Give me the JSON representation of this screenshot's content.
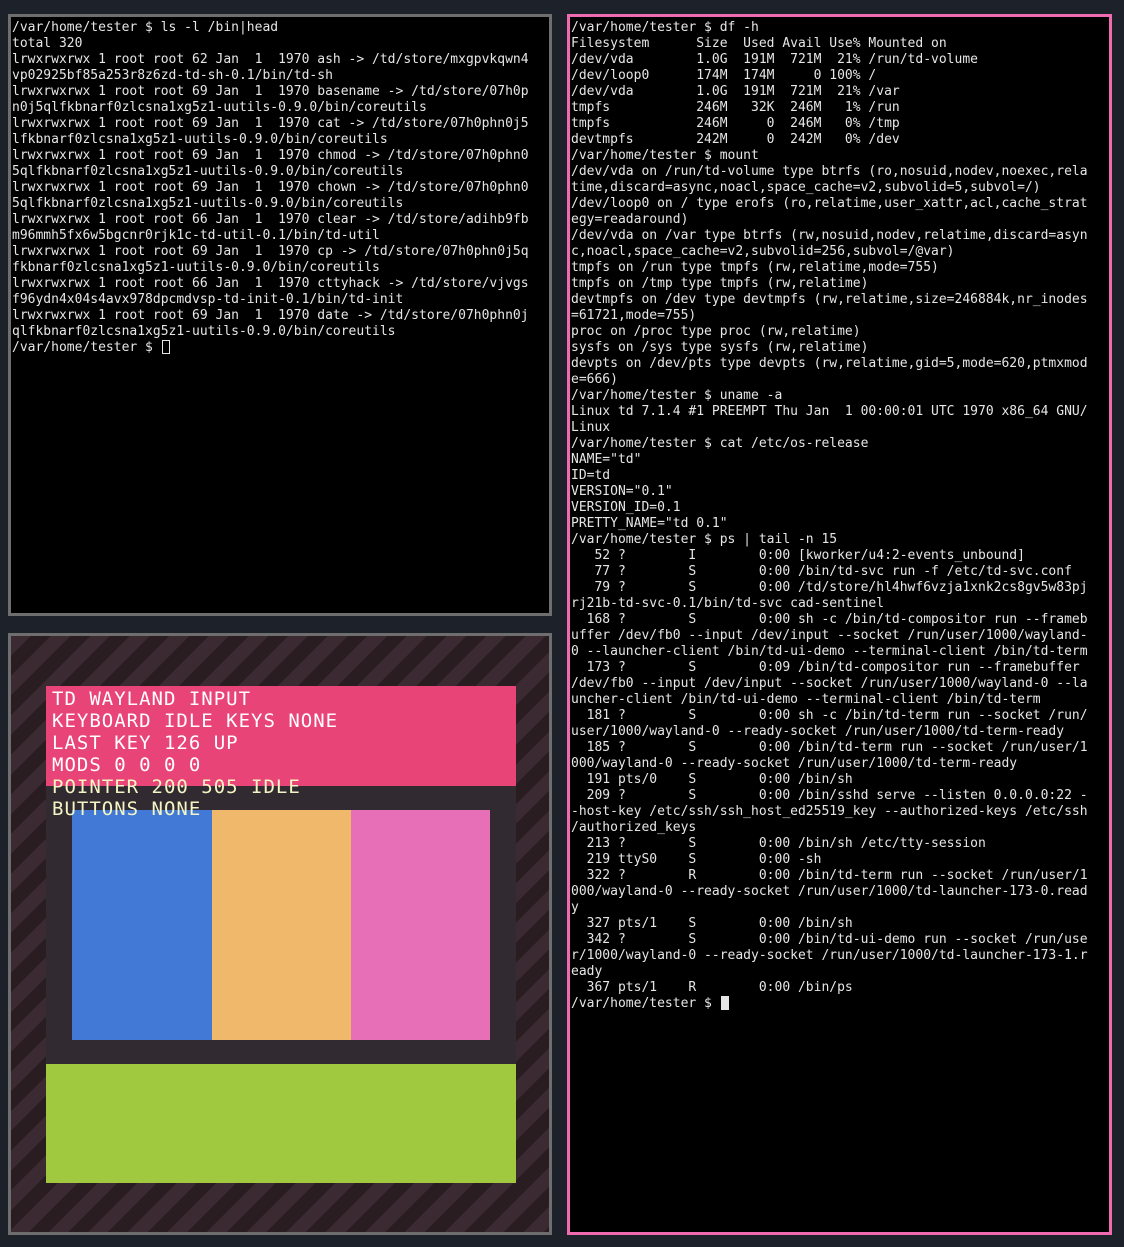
{
  "terminal_left": {
    "lines": [
      "/var/home/tester $ ls -l /bin|head",
      "total 320",
      "lrwxrwxrwx 1 root root 62 Jan  1  1970 ash -> /td/store/mxgpvkqwn4",
      "vp02925bf85a253r8z6zd-td-sh-0.1/bin/td-sh",
      "lrwxrwxrwx 1 root root 69 Jan  1  1970 basename -> /td/store/07h0p",
      "n0j5qlfkbnarf0zlcsna1xg5z1-uutils-0.9.0/bin/coreutils",
      "lrwxrwxrwx 1 root root 69 Jan  1  1970 cat -> /td/store/07h0phn0j5",
      "lfkbnarf0zlcsna1xg5z1-uutils-0.9.0/bin/coreutils",
      "lrwxrwxrwx 1 root root 69 Jan  1  1970 chmod -> /td/store/07h0phn0",
      "5qlfkbnarf0zlcsna1xg5z1-uutils-0.9.0/bin/coreutils",
      "lrwxrwxrwx 1 root root 69 Jan  1  1970 chown -> /td/store/07h0phn0",
      "5qlfkbnarf0zlcsna1xg5z1-uutils-0.9.0/bin/coreutils",
      "lrwxrwxrwx 1 root root 66 Jan  1  1970 clear -> /td/store/adihb9fb",
      "m96mmh5fx6w5bgcnr0rjk1c-td-util-0.1/bin/td-util",
      "lrwxrwxrwx 1 root root 69 Jan  1  1970 cp -> /td/store/07h0phn0j5q",
      "fkbnarf0zlcsna1xg5z1-uutils-0.9.0/bin/coreutils",
      "lrwxrwxrwx 1 root root 66 Jan  1  1970 cttyhack -> /td/store/vjvgs",
      "f96ydn4x04s4avx978dpcmdvsp-td-init-0.1/bin/td-init",
      "lrwxrwxrwx 1 root root 69 Jan  1  1970 date -> /td/store/07h0phn0j",
      "qlfkbnarf0zlcsna1xg5z1-uutils-0.9.0/bin/coreutils"
    ],
    "prompt": "/var/home/tester $ "
  },
  "terminal_right": {
    "lines": [
      "/var/home/tester $ df -h",
      "Filesystem      Size  Used Avail Use% Mounted on",
      "/dev/vda        1.0G  191M  721M  21% /run/td-volume",
      "/dev/loop0      174M  174M     0 100% /",
      "/dev/vda        1.0G  191M  721M  21% /var",
      "tmpfs           246M   32K  246M   1% /run",
      "tmpfs           246M     0  246M   0% /tmp",
      "devtmpfs        242M     0  242M   0% /dev",
      "/var/home/tester $ mount",
      "/dev/vda on /run/td-volume type btrfs (ro,nosuid,nodev,noexec,rela",
      "time,discard=async,noacl,space_cache=v2,subvolid=5,subvol=/)",
      "/dev/loop0 on / type erofs (ro,relatime,user_xattr,acl,cache_strat",
      "egy=readaround)",
      "/dev/vda on /var type btrfs (rw,nosuid,nodev,relatime,discard=asyn",
      "c,noacl,space_cache=v2,subvolid=256,subvol=/@var)",
      "tmpfs on /run type tmpfs (rw,relatime,mode=755)",
      "tmpfs on /tmp type tmpfs (rw,relatime)",
      "devtmpfs on /dev type devtmpfs (rw,relatime,size=246884k,nr_inodes",
      "=61721,mode=755)",
      "proc on /proc type proc (rw,relatime)",
      "sysfs on /sys type sysfs (rw,relatime)",
      "devpts on /dev/pts type devpts (rw,relatime,gid=5,mode=620,ptmxmod",
      "e=666)",
      "/var/home/tester $ uname -a",
      "Linux td 7.1.4 #1 PREEMPT Thu Jan  1 00:00:01 UTC 1970 x86_64 GNU/",
      "Linux",
      "/var/home/tester $ cat /etc/os-release",
      "NAME=\"td\"",
      "ID=td",
      "VERSION=\"0.1\"",
      "VERSION_ID=0.1",
      "PRETTY_NAME=\"td 0.1\"",
      "/var/home/tester $ ps | tail -n 15",
      "   52 ?        I        0:00 [kworker/u4:2-events_unbound]",
      "   77 ?        S        0:00 /bin/td-svc run -f /etc/td-svc.conf",
      "   79 ?        S        0:00 /td/store/hl4hwf6vzja1xnk2cs8gv5w83pj",
      "rj21b-td-svc-0.1/bin/td-svc cad-sentinel",
      "  168 ?        S        0:00 sh -c /bin/td-compositor run --frameb",
      "uffer /dev/fb0 --input /dev/input --socket /run/user/1000/wayland-",
      "0 --launcher-client /bin/td-ui-demo --terminal-client /bin/td-term",
      "  173 ?        S        0:09 /bin/td-compositor run --framebuffer",
      "/dev/fb0 --input /dev/input --socket /run/user/1000/wayland-0 --la",
      "uncher-client /bin/td-ui-demo --terminal-client /bin/td-term",
      "  181 ?        S        0:00 sh -c /bin/td-term run --socket /run/",
      "user/1000/wayland-0 --ready-socket /run/user/1000/td-term-ready",
      "  185 ?        S        0:00 /bin/td-term run --socket /run/user/1",
      "000/wayland-0 --ready-socket /run/user/1000/td-term-ready",
      "  191 pts/0    S        0:00 /bin/sh",
      "  209 ?        S        0:00 /bin/sshd serve --listen 0.0.0.0:22 -",
      "-host-key /etc/ssh/ssh_host_ed25519_key --authorized-keys /etc/ssh",
      "/authorized_keys",
      "  213 ?        S        0:00 /bin/sh /etc/tty-session",
      "  219 ttyS0    S        0:00 -sh",
      "  322 ?        R        0:00 /bin/td-term run --socket /run/user/1",
      "000/wayland-0 --ready-socket /run/user/1000/td-launcher-173-0.read",
      "y",
      "  327 pts/1    S        0:00 /bin/sh",
      "  342 ?        S        0:00 /bin/td-ui-demo run --socket /run/use",
      "r/1000/wayland-0 --ready-socket /run/user/1000/td-launcher-173-1.r",
      "eady",
      "  367 pts/1    R        0:00 /bin/ps"
    ],
    "prompt": "/var/home/tester $ "
  },
  "wayland_demo": {
    "status_lines": [
      "TD WAYLAND INPUT",
      "KEYBOARD IDLE KEYS NONE",
      "LAST KEY 126 UP",
      "MODS 0 0 0 0",
      "POINTER 200 505 IDLE",
      "BUTTONS NONE"
    ],
    "status_colors": [
      "#ffffff",
      "#ffffff",
      "#ffffff",
      "#ffffff",
      "#f3f6c4",
      "#f3f6c4"
    ],
    "swatches": [
      "#4279d6",
      "#efb86a",
      "#e76fb8"
    ],
    "status_bg": "#e84478",
    "bottom_bar": "#a1c93f"
  },
  "colors": {
    "desktop_bg": "#1d212a",
    "active_border": "#ef6aae",
    "inactive_border": "#6e6e6e"
  }
}
